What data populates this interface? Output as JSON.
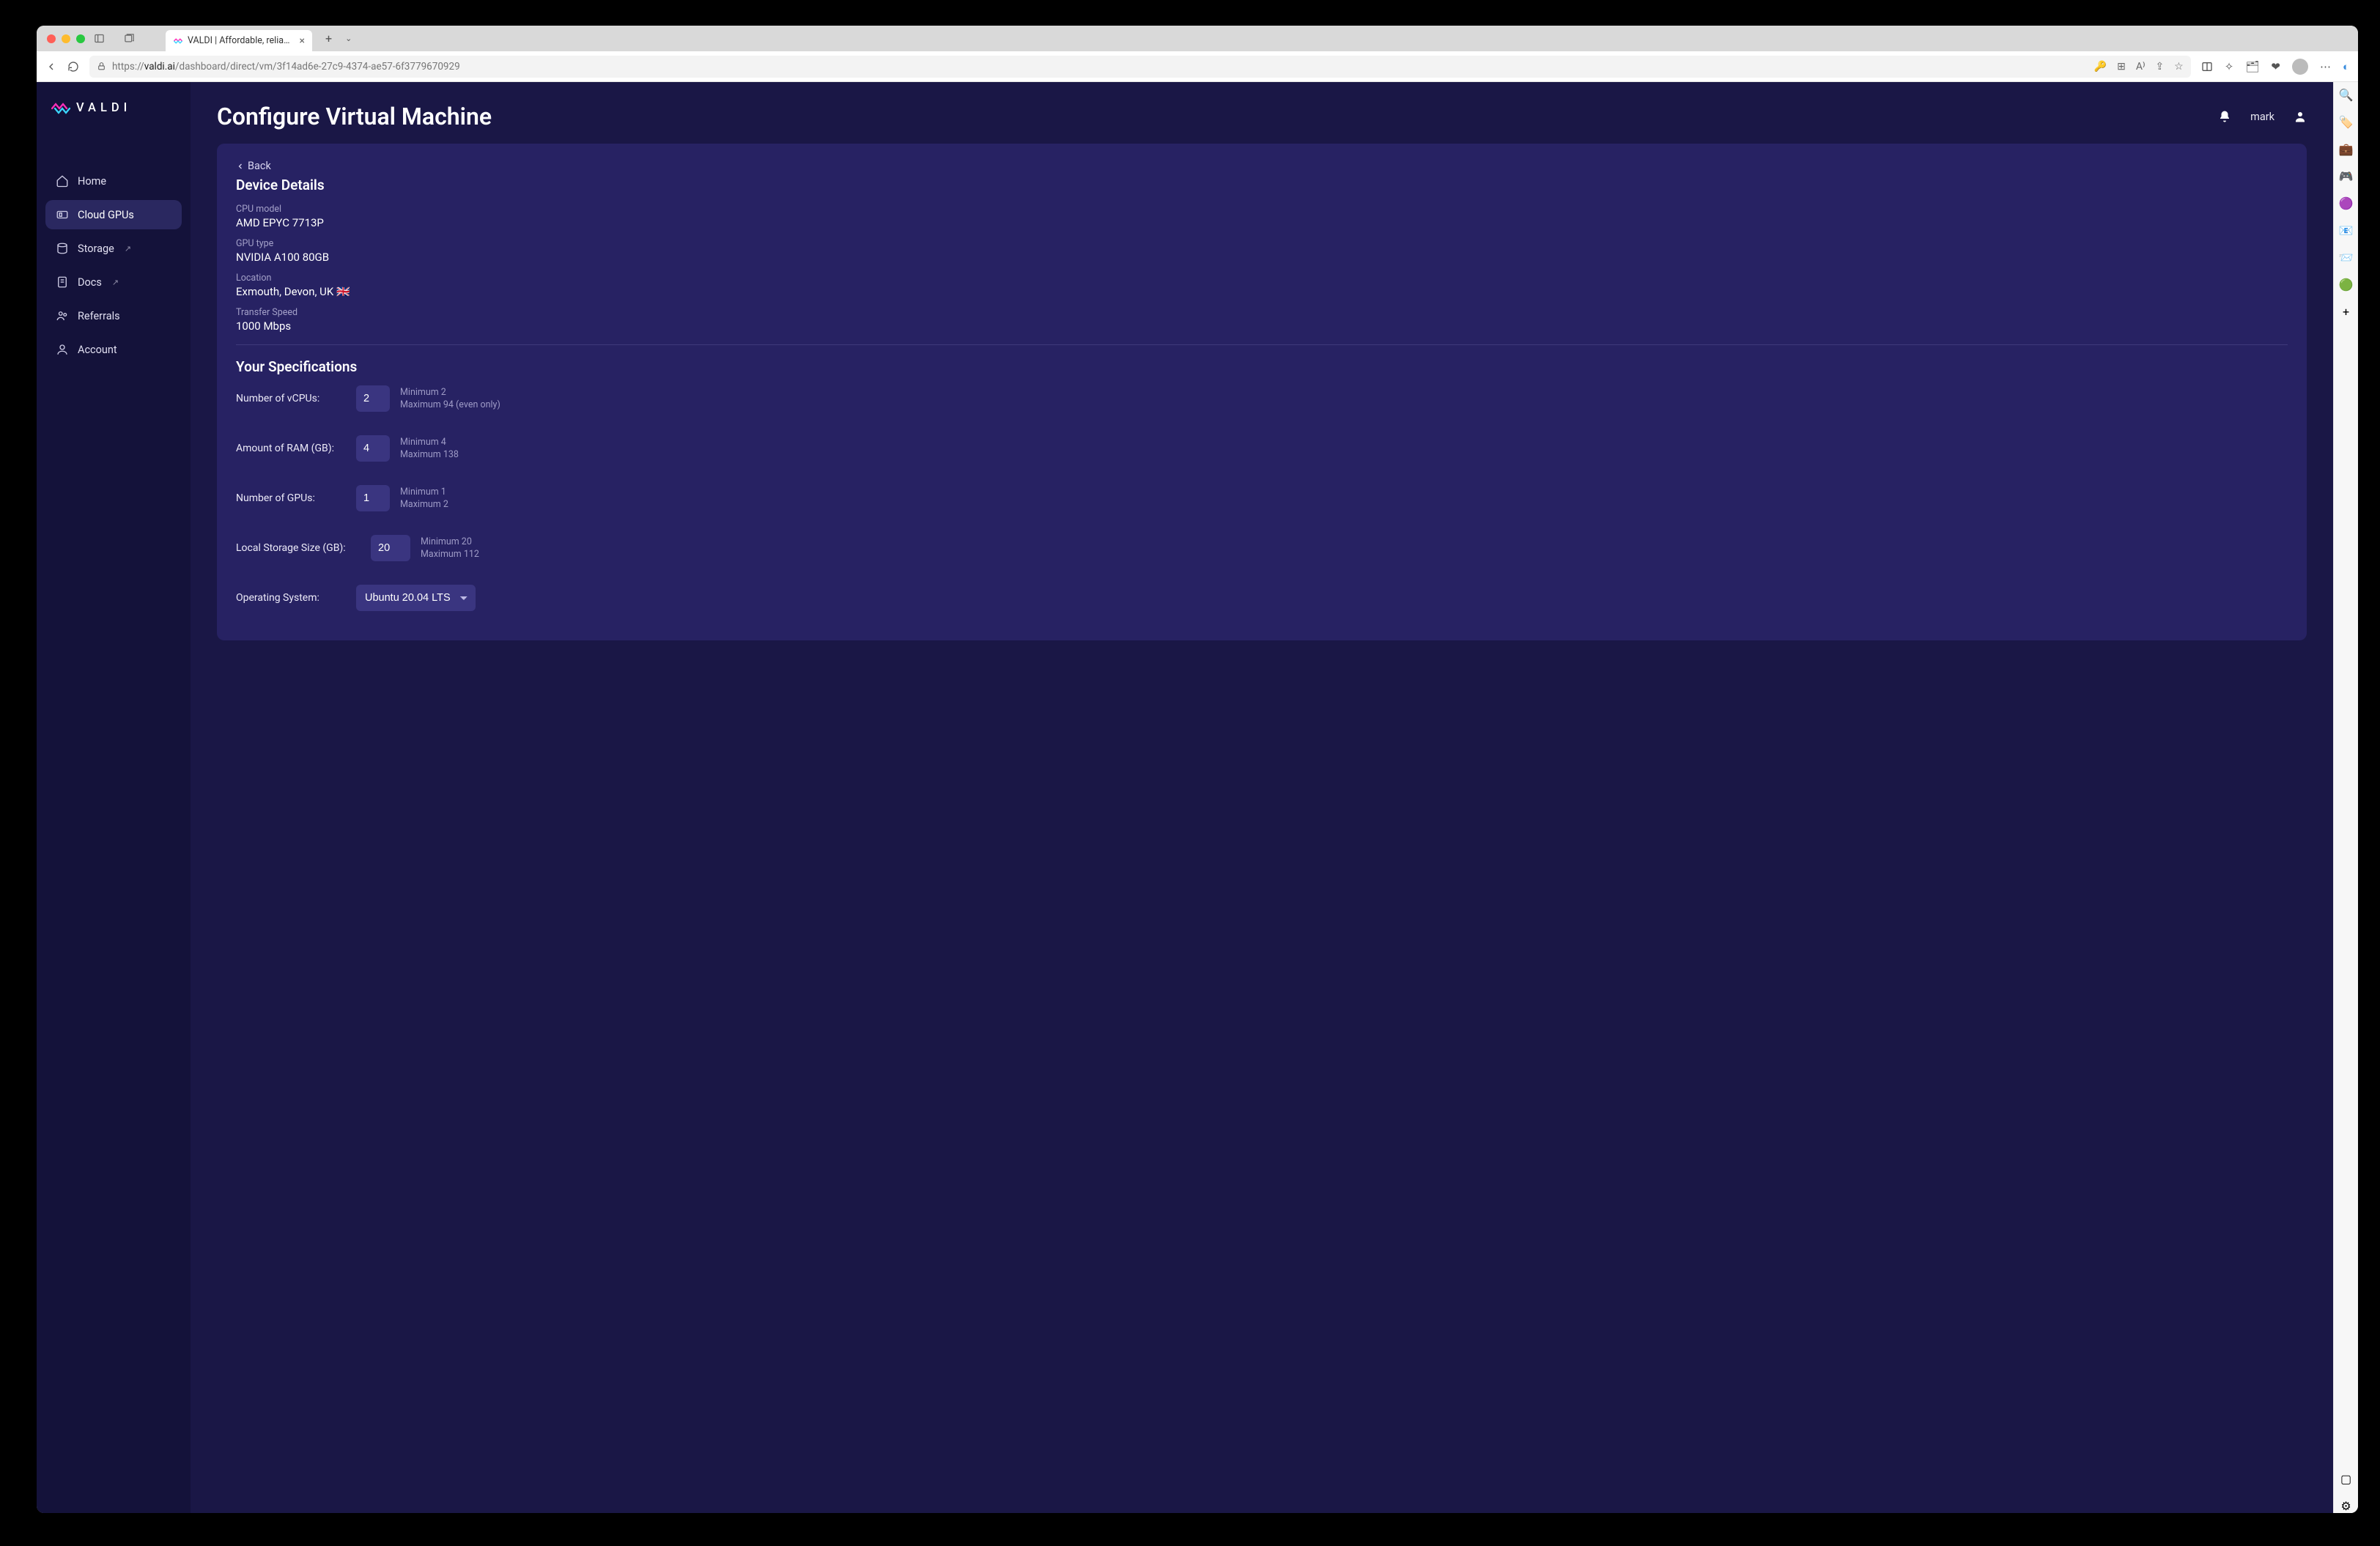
{
  "browser": {
    "tab_title": "VALDI | Affordable, reliable GP…",
    "url_prefix": "https://",
    "url_host": "valdi.ai",
    "url_path": "/dashboard/direct/vm/3f14ad6e-27c9-4374-ae57-6f3779670929"
  },
  "header": {
    "title": "Configure Virtual Machine",
    "username": "mark"
  },
  "sidebar": {
    "brand": "VALDI",
    "items": [
      {
        "label": "Home"
      },
      {
        "label": "Cloud GPUs"
      },
      {
        "label": "Storage"
      },
      {
        "label": "Docs"
      },
      {
        "label": "Referrals"
      },
      {
        "label": "Account"
      }
    ]
  },
  "panel": {
    "back_label": "Back",
    "details_title": "Device Details",
    "details": {
      "cpu_model_label": "CPU model",
      "cpu_model_value": "AMD EPYC 7713P",
      "gpu_type_label": "GPU type",
      "gpu_type_value": "NVIDIA A100 80GB",
      "location_label": "Location",
      "location_value": "Exmouth, Devon, UK 🇬🇧",
      "transfer_label": "Transfer Speed",
      "transfer_value": "1000 Mbps"
    },
    "specs_title": "Your Specifications",
    "specs": {
      "vcpus": {
        "label": "Number of vCPUs:",
        "value": "2",
        "min": "Minimum 2",
        "max": "Maximum 94 (even only)"
      },
      "ram": {
        "label": "Amount of RAM (GB):",
        "value": "4",
        "min": "Minimum 4",
        "max": "Maximum 138"
      },
      "gpus": {
        "label": "Number of GPUs:",
        "value": "1",
        "min": "Minimum 1",
        "max": "Maximum 2"
      },
      "storage": {
        "label": "Local Storage Size (GB):",
        "value": "20",
        "min": "Minimum 20",
        "max": "Maximum 112"
      },
      "os": {
        "label": "Operating System:",
        "value": "Ubuntu 20.04 LTS"
      }
    }
  }
}
